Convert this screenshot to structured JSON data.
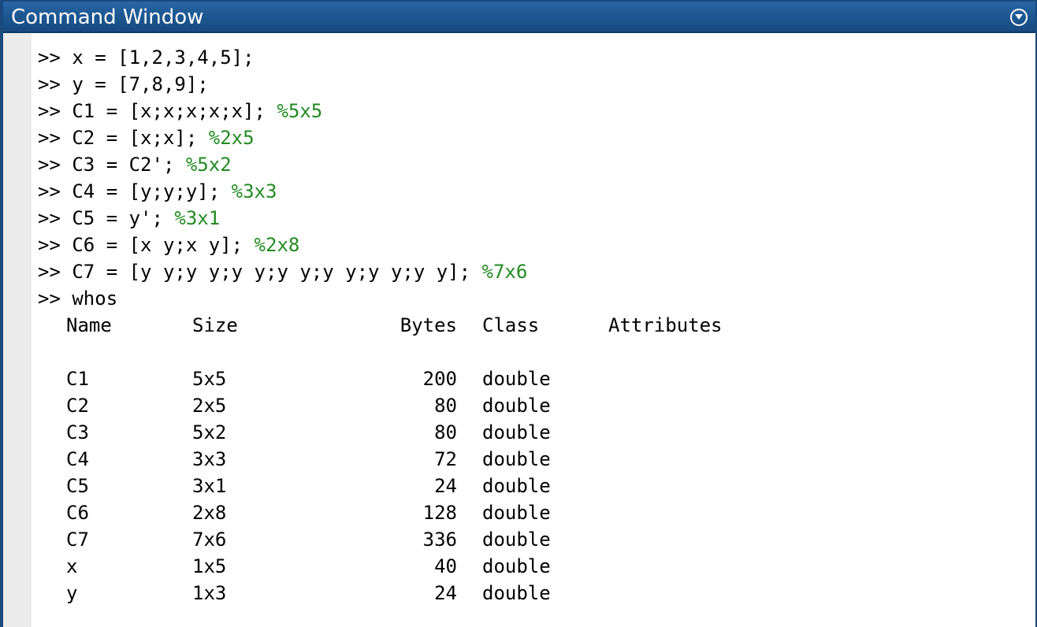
{
  "window": {
    "title": "Command Window",
    "menu_icon": "chevron-circle-down-icon"
  },
  "colors": {
    "titlebar": "#1d5893",
    "comment": "#228b22",
    "gutter": "#ececec"
  },
  "commands": [
    {
      "prompt": ">> ",
      "code": "x = [1,2,3,4,5];",
      "comment": ""
    },
    {
      "prompt": ">> ",
      "code": "y = [7,8,9];",
      "comment": ""
    },
    {
      "prompt": ">> ",
      "code": "C1 = [x;x;x;x;x]; ",
      "comment": "%5x5"
    },
    {
      "prompt": ">> ",
      "code": "C2 = [x;x]; ",
      "comment": "%2x5"
    },
    {
      "prompt": ">> ",
      "code": "C3 = C2'; ",
      "comment": "%5x2"
    },
    {
      "prompt": ">> ",
      "code": "C4 = [y;y;y]; ",
      "comment": "%3x3"
    },
    {
      "prompt": ">> ",
      "code": "C5 = y'; ",
      "comment": "%3x1"
    },
    {
      "prompt": ">> ",
      "code": "C6 = [x y;x y]; ",
      "comment": "%2x8"
    },
    {
      "prompt": ">> ",
      "code": "C7 = [y y;y y;y y;y y;y y;y y;y y]; ",
      "comment": "%7x6"
    },
    {
      "prompt": ">> ",
      "code": "whos",
      "comment": ""
    }
  ],
  "whos": {
    "headers": {
      "name": "Name",
      "size": "Size",
      "bytes": "Bytes",
      "class": "Class",
      "attributes": "Attributes"
    },
    "rows": [
      {
        "name": "C1",
        "size": "5x5",
        "bytes": "200",
        "class": "double",
        "attributes": ""
      },
      {
        "name": "C2",
        "size": "2x5",
        "bytes": "80",
        "class": "double",
        "attributes": ""
      },
      {
        "name": "C3",
        "size": "5x2",
        "bytes": "80",
        "class": "double",
        "attributes": ""
      },
      {
        "name": "C4",
        "size": "3x3",
        "bytes": "72",
        "class": "double",
        "attributes": ""
      },
      {
        "name": "C5",
        "size": "3x1",
        "bytes": "24",
        "class": "double",
        "attributes": ""
      },
      {
        "name": "C6",
        "size": "2x8",
        "bytes": "128",
        "class": "double",
        "attributes": ""
      },
      {
        "name": "C7",
        "size": "7x6",
        "bytes": "336",
        "class": "double",
        "attributes": ""
      },
      {
        "name": "x",
        "size": "1x5",
        "bytes": "40",
        "class": "double",
        "attributes": ""
      },
      {
        "name": "y",
        "size": "1x3",
        "bytes": "24",
        "class": "double",
        "attributes": ""
      }
    ]
  }
}
